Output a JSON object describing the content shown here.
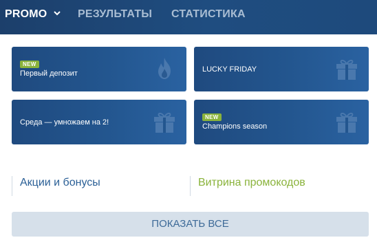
{
  "nav": {
    "tabs": [
      {
        "label": "PROMO",
        "active": true
      },
      {
        "label": "РЕЗУЛЬТАТЫ",
        "active": false
      },
      {
        "label": "СТАТИСТИКА",
        "active": false
      }
    ]
  },
  "cards": [
    {
      "badge": "NEW",
      "title": "Первый депозит",
      "icon": "flame-icon"
    },
    {
      "badge": "",
      "title": "LUCKY FRIDAY",
      "icon": "gift-icon"
    },
    {
      "badge": "",
      "title": "Среда — умножаем на 2!",
      "icon": "gift-icon"
    },
    {
      "badge": "NEW",
      "title": "Champions season",
      "icon": "gift-icon"
    }
  ],
  "links": {
    "promotions": "Акции и бонусы",
    "promo_codes": "Витрина промокодов"
  },
  "show_all": "ПОКАЗАТЬ ВСЕ",
  "colors": {
    "nav_bg": "#1f4d80",
    "card_bg": "#23568f",
    "badge": "#8ab33b",
    "link_blue": "#2a5f96",
    "link_green": "#8ab33b",
    "button_bg": "#d6e0ea"
  }
}
